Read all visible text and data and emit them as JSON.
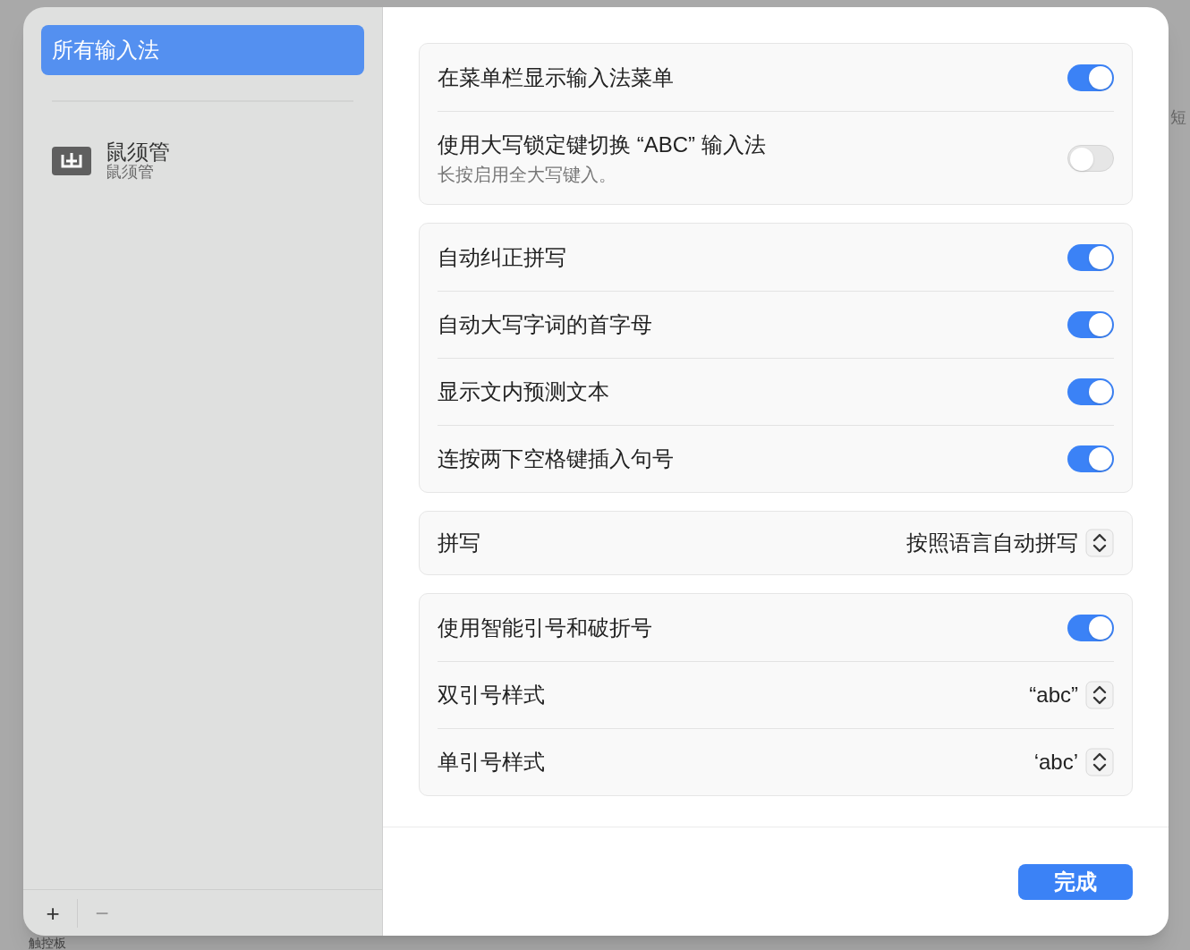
{
  "background": {
    "labels": [
      "触控板",
      "短"
    ]
  },
  "sidebar": {
    "items": [
      {
        "label": "所有输入法",
        "selected": true
      },
      {
        "label": "鼠须管",
        "sublabel": "鼠须管",
        "selected": false
      }
    ],
    "buttons": [
      "+",
      "−"
    ]
  },
  "sections": [
    {
      "rows": [
        {
          "kind": "toggle",
          "label": "在菜单栏显示输入法菜单",
          "on": true
        },
        {
          "kind": "toggle",
          "label": "使用大写锁定键切换 “ABC” 输入法",
          "sublabel": "长按启用全大写键入。",
          "on": false
        }
      ]
    },
    {
      "rows": [
        {
          "kind": "toggle",
          "label": "自动纠正拼写",
          "on": true
        },
        {
          "kind": "toggle",
          "label": "自动大写字词的首字母",
          "on": true
        },
        {
          "kind": "toggle",
          "label": "显示文内预测文本",
          "on": true
        },
        {
          "kind": "toggle",
          "label": "连按两下空格键插入句号",
          "on": true
        }
      ]
    },
    {
      "rows": [
        {
          "kind": "popup",
          "label": "拼写",
          "value": "按照语言自动拼写"
        }
      ]
    },
    {
      "rows": [
        {
          "kind": "toggle",
          "label": "使用智能引号和破折号",
          "on": true
        },
        {
          "kind": "popup",
          "label": "双引号样式",
          "value": "“abc”"
        },
        {
          "kind": "popup",
          "label": "单引号样式",
          "value": "‘abc’"
        }
      ]
    }
  ],
  "done_button": "完成"
}
